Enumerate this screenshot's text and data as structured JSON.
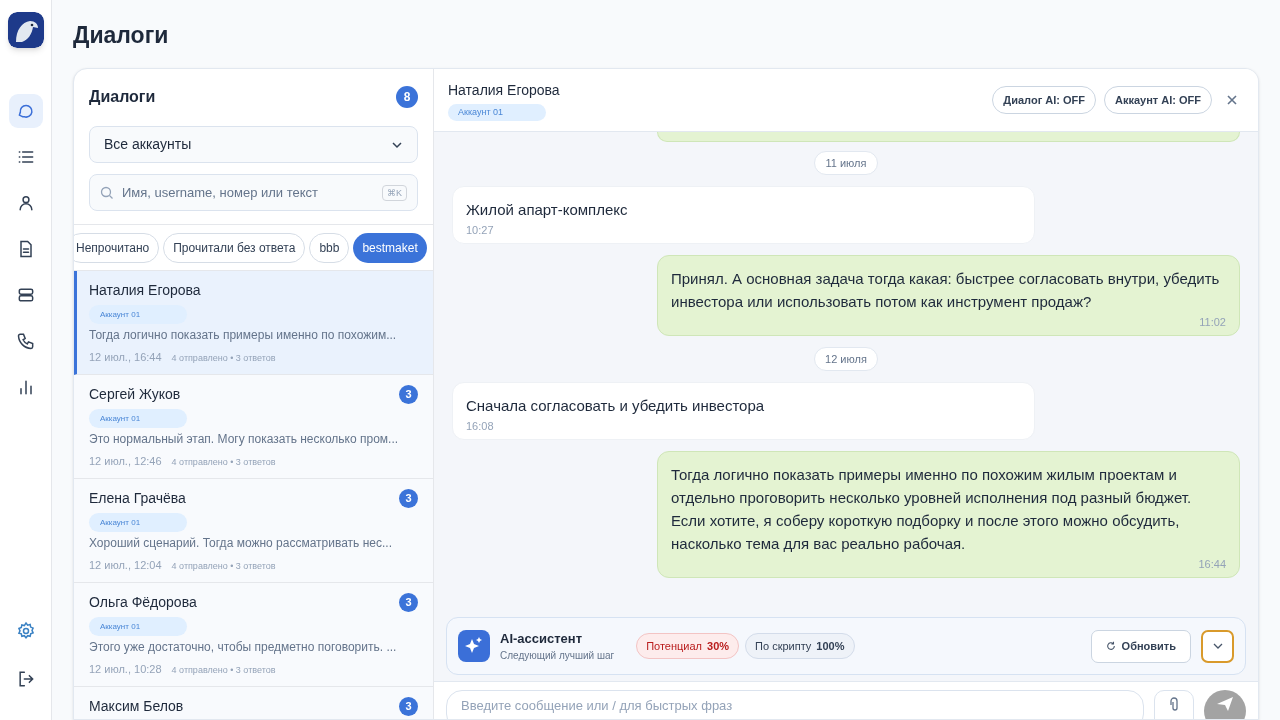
{
  "nav": [
    {
      "kind": "chat",
      "selected": true
    },
    {
      "kind": "list",
      "selected": false
    },
    {
      "kind": "user",
      "selected": false
    },
    {
      "kind": "document",
      "selected": false
    },
    {
      "kind": "server",
      "selected": false
    },
    {
      "kind": "phone",
      "selected": false
    },
    {
      "kind": "chart",
      "selected": false
    }
  ],
  "nav_bottom": [
    {
      "kind": "settings"
    },
    {
      "kind": "logout"
    }
  ],
  "page_title": "Диалоги",
  "list_panel": {
    "title": "Диалоги",
    "count": "8",
    "account_select": "Все аккаунты",
    "search": {
      "placeholder": "Имя, username, номер или текст",
      "shortcut": "⌘K"
    },
    "filters": [
      {
        "label": "Непрочитано",
        "selected": false
      },
      {
        "label": "Прочитали без ответа",
        "selected": false
      },
      {
        "label": "bbb",
        "selected": false
      },
      {
        "label": "bestmaket",
        "selected": true
      }
    ],
    "dialogs": [
      {
        "name": "Наталия Егорова",
        "account": "Аккаунт 01",
        "preview": "Тогда логично показать примеры именно по похожим...",
        "time": "12 июл., 16:44",
        "stats": "4 отправлено • 3 ответов",
        "selected": true
      },
      {
        "name": "Сергей Жуков",
        "unread": "3",
        "account": "Аккаунт 01",
        "preview": "Это нормальный этап. Могу показать несколько пром...",
        "time": "12 июл., 12:46",
        "stats": "4 отправлено • 3 ответов",
        "selected": false
      },
      {
        "name": "Елена Грачёва",
        "unread": "3",
        "account": "Аккаунт 01",
        "preview": "Хороший сценарий. Тогда можно рассматривать нес...",
        "time": "12 июл., 12:04",
        "stats": "4 отправлено • 3 ответов",
        "selected": false
      },
      {
        "name": "Ольга Фёдорова",
        "unread": "3",
        "account": "Аккаунт 01",
        "preview": "Этого уже достаточно, чтобы предметно поговорить. ...",
        "time": "12 июл., 10:28",
        "stats": "4 отправлено • 3 ответов",
        "selected": false
      },
      {
        "name": "Максим Белов",
        "unread": "3",
        "selected": false
      }
    ]
  },
  "chat": {
    "contact": "Наталия Егорова",
    "account": "Аккаунт 01",
    "toggles": [
      "Диалог AI: OFF",
      "Аккаунт AI: OFF"
    ],
    "messages": [
      {
        "kind": "cut_outgoing"
      },
      {
        "kind": "date",
        "text": "11 июля"
      },
      {
        "kind": "incoming",
        "text": "Жилой апарт-комплекс",
        "time": "10:27"
      },
      {
        "kind": "outgoing",
        "text": "Принял. А основная задача тогда какая: быстрее согласовать внутри, убедить инвестора или использовать потом как инструмент продаж?",
        "time": "11:02"
      },
      {
        "kind": "date",
        "text": "12 июля"
      },
      {
        "kind": "incoming",
        "text": "Сначала согласовать и убедить инвестора",
        "time": "16:08"
      },
      {
        "kind": "outgoing",
        "text": "Тогда логично показать примеры именно по похожим жилым проектам и отдельно проговорить несколько уровней исполнения под разный бюджет. Если хотите, я соберу короткую подборку и после этого можно обсудить, насколько тема для вас реально рабочая.",
        "time": "16:44"
      }
    ],
    "assistant": {
      "title": "AI-ассистент",
      "subtitle": "Следующий лучший шаг",
      "metrics": [
        {
          "label": "Потенциал",
          "value": "30%",
          "kind": "warning"
        },
        {
          "label": "По скрипту",
          "value": "100%",
          "kind": "info"
        }
      ],
      "refresh": "Обновить"
    },
    "composer": {
      "placeholder": "Введите сообщение или / для быстрых фраз"
    }
  }
}
